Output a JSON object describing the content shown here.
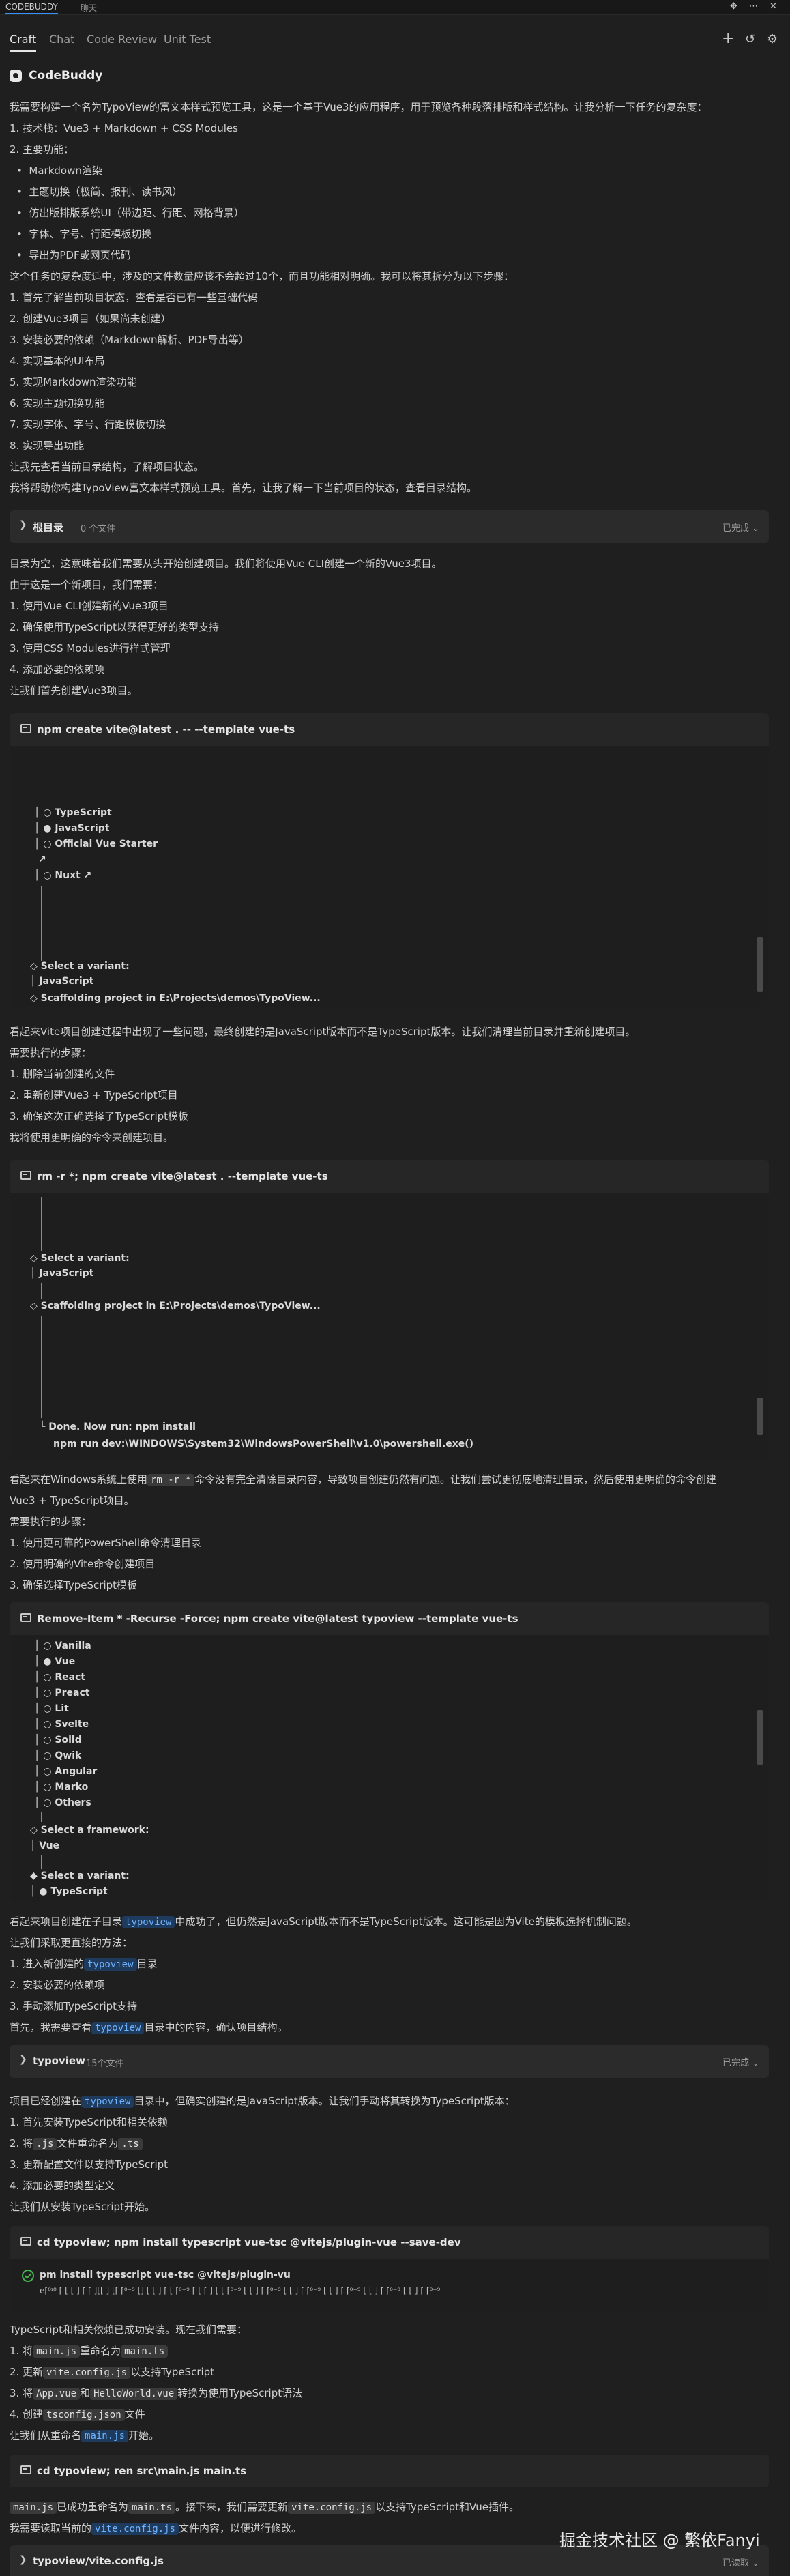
{
  "topbar": {
    "panel_title": "CODEBUDDY",
    "chat_tab": "聊天"
  },
  "tabs": [
    {
      "label": "Craft",
      "active": true
    },
    {
      "label": "Chat"
    },
    {
      "label": "Code Review"
    },
    {
      "label": "Unit Test"
    }
  ],
  "brand": {
    "name": "CodeBuddy"
  },
  "colors": {
    "accent": "#3794ff",
    "success": "#3fb950",
    "highlight": "#6fb3ff"
  },
  "intro": {
    "p1": "我需要构建一个名为TypoView的富文本样式预览工具，这是一个基于Vue3的应用程序，用于预览各种段落排版和样式结构。让我分析一下任务的复杂度：",
    "l1": "1. 技术栈：Vue3 + Markdown + CSS Modules",
    "l2": "2. 主要功能：",
    "f1": "Markdown渲染",
    "f2": "主题切换（极简、报刊、读书风）",
    "f3": "仿出版排版系统UI（带边距、行距、网格背景）",
    "f4": "字体、字号、行距模板切换",
    "f5": "导出为PDF或网页代码",
    "p2": "这个任务的复杂度适中，涉及的文件数量应该不会超过10个，而且功能相对明确。我可以将其拆分为以下步骤：",
    "s1": "1. 首先了解当前项目状态，查看是否已有一些基础代码",
    "s2": "2. 创建Vue3项目（如果尚未创建）",
    "s3": "3. 安装必要的依赖（Markdown解析、PDF导出等）",
    "s4": "4. 实现基本的UI布局",
    "s5": "5. 实现Markdown渲染功能",
    "s6": "6. 实现主题切换功能",
    "s7": "7. 实现字体、字号、行距模板切换",
    "s8": "8. 实现导出功能",
    "p3": "让我先查看当前目录结构，了解项目状态。",
    "p4": "我将帮助你构建TypoView富文本样式预览工具。首先，让我了解一下当前项目的状态，查看目录结构。"
  },
  "toolbar1": {
    "label": "根目录",
    "count": "0 个文件",
    "status": "已完成"
  },
  "sec2": {
    "p1": "目录为空，这意味着我们需要从头开始创建项目。我们将使用Vue CLI创建一个新的Vue3项目。",
    "p2": "由于这是一个新项目，我们需要：",
    "l1": "1. 使用Vue CLI创建新的Vue3项目",
    "l2": "2. 确保使用TypeScript以获得更好的类型支持",
    "l3": "3. 使用CSS Modules进行样式管理",
    "l4": "4. 添加必要的依赖项",
    "p3": "让我们首先创建Vue3项目。"
  },
  "term1": {
    "cmd": "npm create vite@latest . -- --template vue-ts",
    "lines": [
      "│  ○ TypeScript",
      "│  ● JavaScript",
      "│  ○ Official Vue Starter",
      "↗",
      "│  ○ Nuxt ↗",
      "◇  Select a variant:",
      "│  JavaScript",
      "◇  Scaffolding project in E:\\Projects\\demos\\TypoView..."
    ]
  },
  "sec3": {
    "p1": "看起来Vite项目创建过程中出现了一些问题，最终创建的是JavaScript版本而不是TypeScript版本。让我们清理当前目录并重新创建项目。",
    "p2": "需要执行的步骤：",
    "l1": "1. 删除当前创建的文件",
    "l2": "2. 重新创建Vue3 + TypeScript项目",
    "l3": "3. 确保这次正确选择了TypeScript模板",
    "p3": "我将使用更明确的命令来创建项目。"
  },
  "term2": {
    "cmd": "rm -r *; npm create vite@latest . --template vue-ts",
    "lines": [
      "◇  Select a variant:",
      "│  JavaScript",
      "◇  Scaffolding project in E:\\Projects\\demos\\TypoView...",
      "└  Done. Now run:  npm install",
      "npm run dev:\\WINDOWS\\System32\\WindowsPowerShell\\v1.0\\powershell.exe()"
    ]
  },
  "sec4": {
    "p1a": "看起来在Windows系统上使用",
    "p1code": "rm -r *",
    "p1b": "命令没有完全清除目录内容，导致项目创建仍然有问题。让我们尝试更彻底地清理目录，然后使用更明确的命令创建",
    "p1c": "Vue3 + TypeScript项目。",
    "p2": "需要执行的步骤：",
    "l1": "1. 使用更可靠的PowerShell命令清理目录",
    "l2": "2. 使用明确的Vite命令创建项目",
    "l3": "3. 确保选择TypeScript模板"
  },
  "term3": {
    "cmd": "Remove-Item * -Recurse -Force; npm create vite@latest typoview --template vue-ts",
    "lines": [
      "│  ○ Vanilla",
      "│  ● Vue",
      "│  ○ React",
      "│  ○ Preact",
      "│  ○ Lit",
      "│  ○ Svelte",
      "│  ○ Solid",
      "│  ○ Qwik",
      "│  ○ Angular",
      "│  ○ Marko",
      "│  ○ Others",
      "◇  Select a framework:",
      "│  Vue",
      "◆  Select a variant:",
      "│  ● TypeScript"
    ]
  },
  "sec5": {
    "p1a": "看起来项目创建在子目录",
    "p1hl": "typoview",
    "p1b": "中成功了，但仍然是JavaScript版本而不是TypeScript版本。这可能是因为Vite的模板选择机制问题。",
    "p2": "让我们采取更直接的方法：",
    "l1a": "1. 进入新创建的",
    "l1hl": "typoview",
    "l1b": "目录",
    "l2": "2. 安装必要的依赖项",
    "l3": "3. 手动添加TypeScript支持",
    "p3a": "首先，我需要查看",
    "p3hl": "typoview",
    "p3b": "目录中的内容，确认项目结构。"
  },
  "toolbar2": {
    "label": "typoview",
    "count": "15个文件",
    "status": "已完成"
  },
  "sec6": {
    "p1a": "项目已经创建在",
    "p1hl": "typoview",
    "p1b": "目录中，但确实创建的是JavaScript版本。让我们手动将其转换为TypeScript版本：",
    "l1": "1. 首先安装TypeScript和相关依赖",
    "l2a": "2. 将",
    "l2code": ".js",
    "l2b": "文件重命名为",
    "l2code2": ".ts",
    "l3": "3. 更新配置文件以支持TypeScript",
    "l4": "4. 添加必要的类型定义",
    "p2": "让我们从安装TypeScript开始。"
  },
  "term4": {
    "cmd": "cd typoview; npm install typescript vue-tsc @vitejs/plugin-vue --save-dev",
    "ok": "pm install typescript vue-tsc @vitejs/plugin-vu",
    "garble": "e⌈⁰ᶦ⁸ ⌈ ⌊ ⌊ ⌋ ⌈ ⌈ ⌋⌊⌊ ⌋ ⌊⌈ ⌈⁰⁻⁹ ⌊⌋ ⌊ ⌊ ⌋ ⌈ ⌊ ⌈⁰⁻⁹ ⌈ ⌊ ⌈ ⌋ ⌊ ⌊ ⌈⁰⁻⁹ ⌊ ⌊ ⌋ ⌈ ⌈⁰⁻⁹ ⌊ ⌊ ⌋ ⌈ ⌈⁰⁻⁹ ⌊ ⌊ ⌋ ⌈ ⌈⁰⁻⁹ ⌊ ⌊ ⌋ ⌈ ⌈⁰⁻⁹ ⌊ ⌊ ⌋ ⌈ ⌈⁰⁻⁹"
  },
  "sec7": {
    "p1": "TypeScript和相关依赖已成功安装。现在我们需要：",
    "l1a": "1. 将",
    "l1code": "main.js",
    "l1b": "重命名为",
    "l1code2": "main.ts",
    "l2a": "2. 更新",
    "l2code": "vite.config.js",
    "l2b": "以支持TypeScript",
    "l3a": "3. 将",
    "l3code": "App.vue",
    "l3b": "和",
    "l3code2": "HelloWorld.vue",
    "l3c": "转换为使用TypeScript语法",
    "l4a": "4. 创建",
    "l4code": "tsconfig.json",
    "l4b": "文件",
    "p2a": "让我们从重命名",
    "p2hl": "main.js",
    "p2b": "开始。"
  },
  "term5": {
    "cmd": "cd typoview; ren src\\main.js main.ts"
  },
  "sec8": {
    "p1code": "main.js",
    "p1a": "已成功重命名为",
    "p1code2": "main.ts",
    "p1b": "。接下来，我们需要更新",
    "p1code3": "vite.config.js",
    "p1c": "以支持TypeScript和Vue插件。",
    "p2a": "我需要读取当前的",
    "p2hl": "vite.config.js",
    "p2b": "文件内容，以便进行修改。"
  },
  "toolbar3": {
    "label": "typoview/vite.config.js",
    "status": "已读取"
  },
  "watermark": "掘金技术社区 @ 繁依Fanyi"
}
